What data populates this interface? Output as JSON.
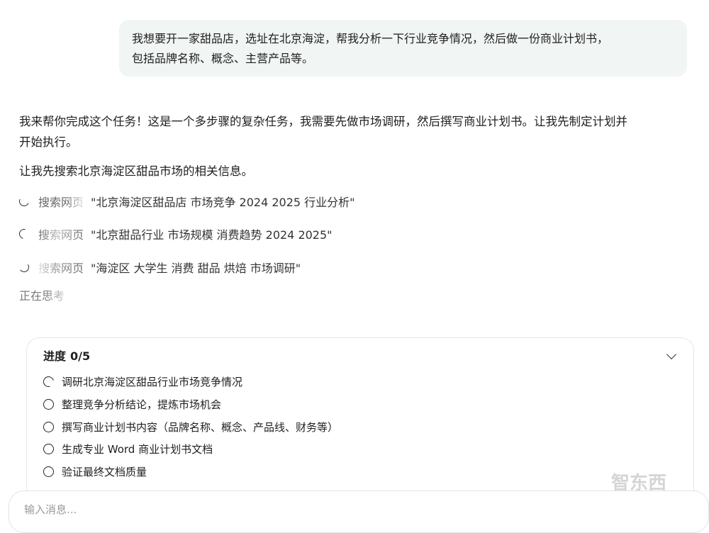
{
  "user_message": {
    "line1": "我想要开一家甜品店，选址在北京海淀，帮我分析一下行业竞争情况，然后做一份商业计划书，",
    "line2": "包括品牌名称、概念、主营产品等。"
  },
  "assistant": {
    "para1_line1": "我来帮你完成这个任务！这是一个多步骤的复杂任务，我需要先做市场调研，然后撰写商业计划书。让我先制定计划并",
    "para1_line2": "开始执行。",
    "para2": "让我先搜索北京海淀区甜品市场的相关信息。",
    "searches": [
      {
        "label": "搜索网页",
        "query": "\"北京海淀区甜品店 市场竞争 2024 2025 行业分析\""
      },
      {
        "label": "搜索网页",
        "query": "\"北京甜品行业 市场规模 消费趋势 2024 2025\""
      },
      {
        "label": "搜索网页",
        "query": "\"海淀区 大学生 消费 甜品 烘焙 市场调研\""
      }
    ],
    "thinking": "正在思考"
  },
  "progress": {
    "title": "进度",
    "count": "0/5",
    "tasks": [
      {
        "label": "调研北京海淀区甜品行业市场竞争情况",
        "status": "in-progress"
      },
      {
        "label": "整理竞争分析结论，提炼市场机会",
        "status": "pending"
      },
      {
        "label": "撰写商业计划书内容（品牌名称、概念、产品线、财务等）",
        "status": "pending"
      },
      {
        "label": "生成专业 Word 商业计划书文档",
        "status": "pending"
      },
      {
        "label": "验证最终文档质量",
        "status": "pending"
      }
    ]
  },
  "composer": {
    "placeholder": "输入消息..."
  },
  "watermark": {
    "text": "智东西"
  }
}
